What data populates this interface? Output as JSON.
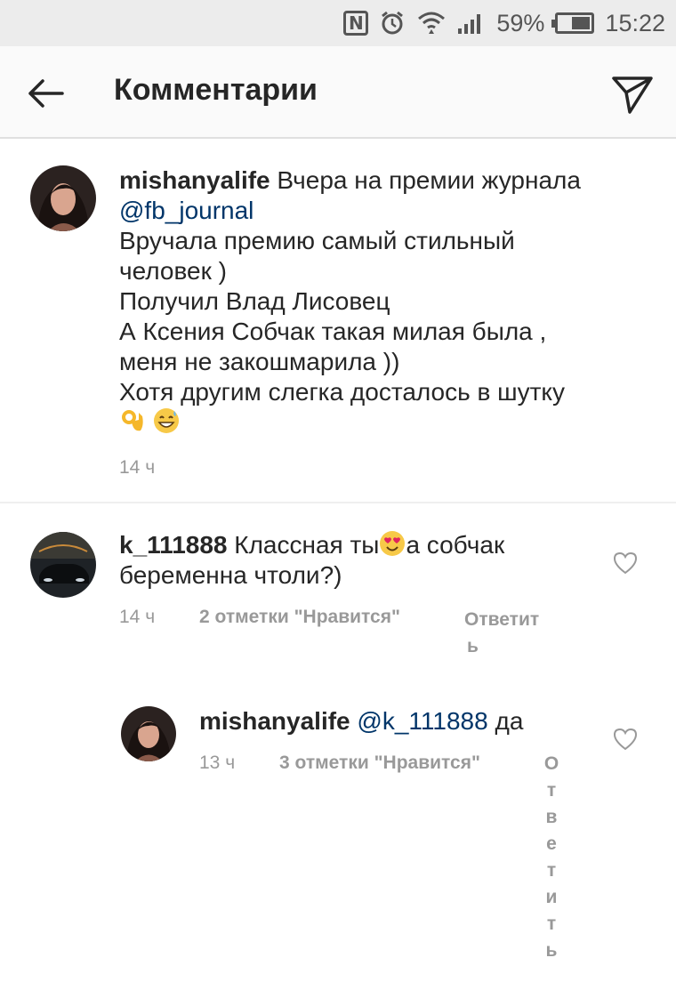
{
  "status_bar": {
    "battery": "59%",
    "battery_level": 0.59,
    "time": "15:22",
    "icons": [
      "nfc-icon",
      "alarm-icon",
      "wifi-icon",
      "signal-icon",
      "battery-icon"
    ]
  },
  "header": {
    "title": "Комментарии",
    "back_icon": "arrow-left-icon",
    "send_icon": "paper-plane-icon"
  },
  "caption": {
    "username": "mishanyalife",
    "text_line1": "Вчера на премии журнала",
    "mention": "@fb_journal",
    "lines": [
      "Вручала премию самый стильный",
      "человек )",
      "Получил Влад Лисовец",
      "А Ксения Собчак такая милая была ,",
      "меня не закошмарила ))",
      "Хотя другим слегка досталось в шутку"
    ],
    "emojis": [
      "ok-hand-emoji",
      "grinning-sweat-emoji"
    ],
    "time": "14 ч"
  },
  "comments": [
    {
      "username": "k_111888",
      "text_before_emoji": "Классная ты",
      "emoji": "heart-eyes-emoji",
      "text_after_emoji": "а собчак",
      "text_line2": "беременна чтоли?)",
      "time": "14 ч",
      "likes": "2 отметки \"Нравится\"",
      "reply_line1": "Ответит",
      "reply_line2": "ь"
    }
  ],
  "reply": {
    "username": "mishanyalife",
    "mention": "@k_111888",
    "text": "да",
    "time": "13 ч",
    "likes": "3 отметки \"Нравится\"",
    "reply_chars": [
      "О",
      "т",
      "в",
      "е",
      "т",
      "и",
      "т",
      "ь"
    ]
  }
}
